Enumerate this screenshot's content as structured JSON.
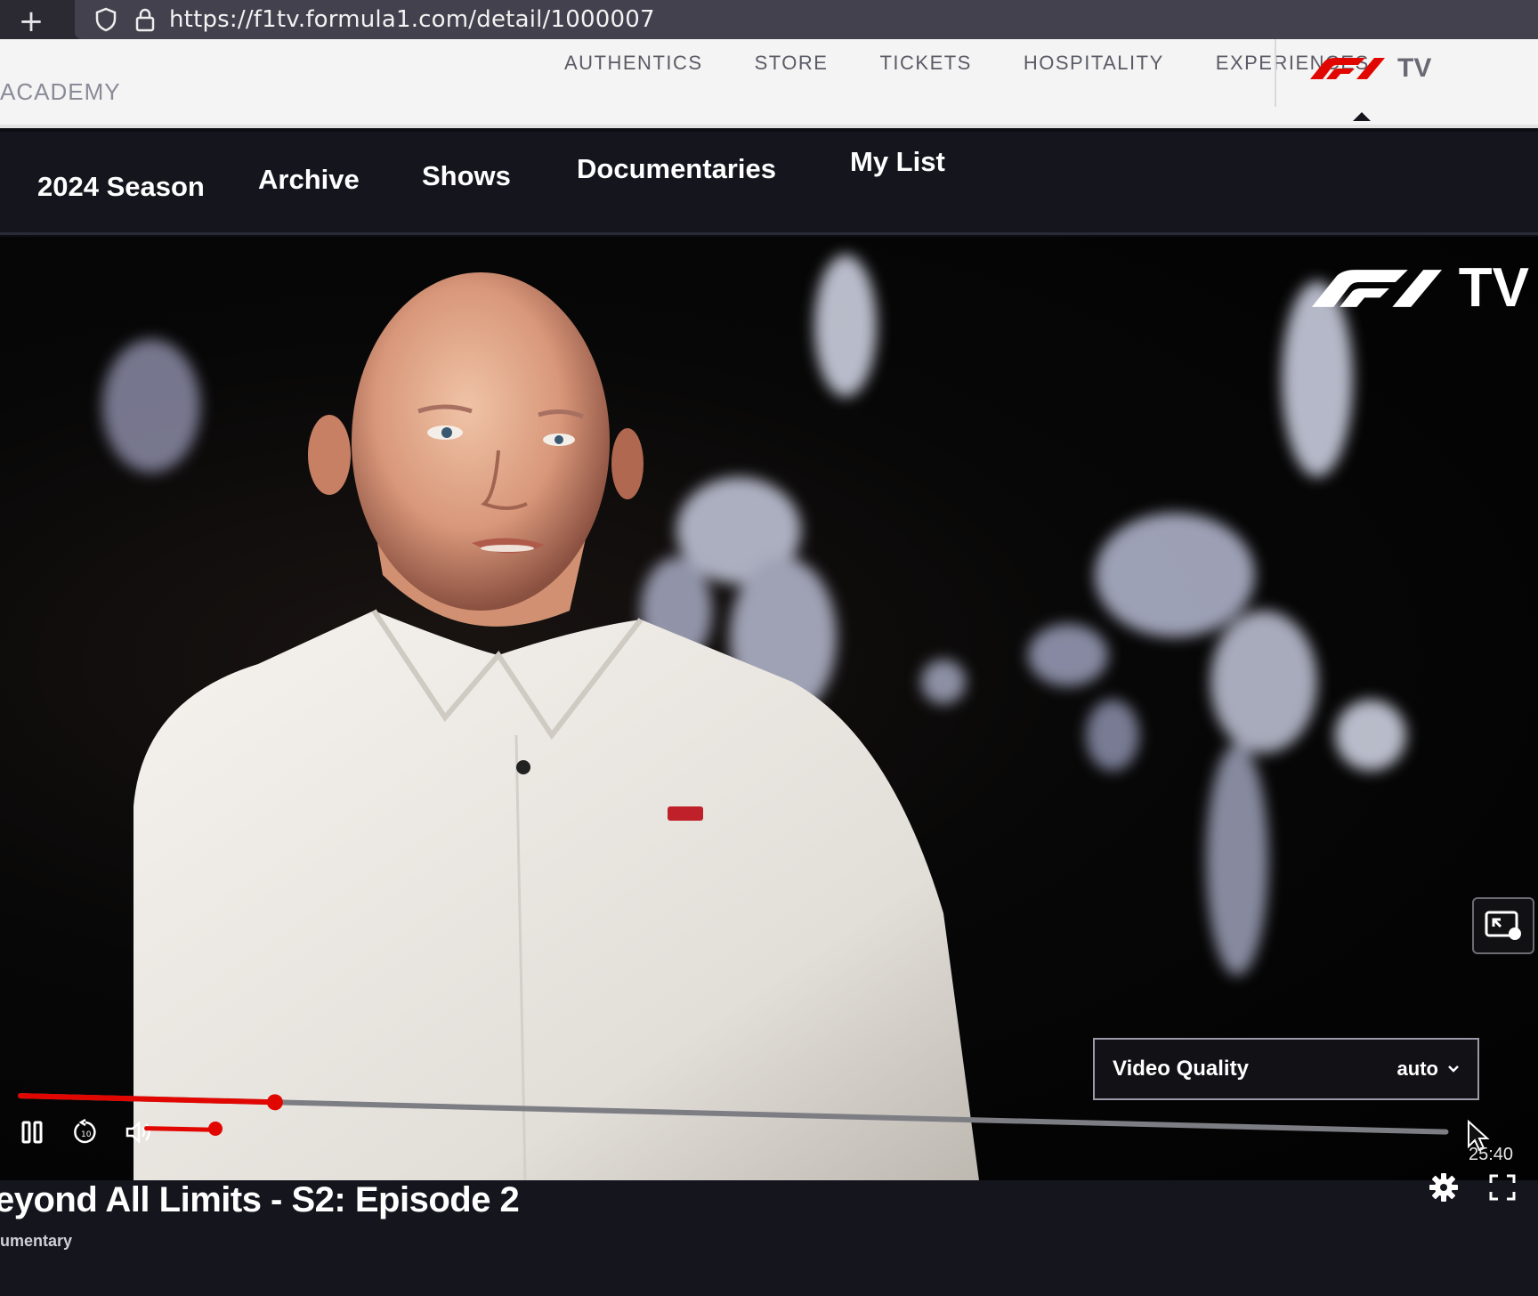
{
  "browser": {
    "url": "https://f1tv.formula1.com/detail/1000007",
    "icons": [
      "plus-icon",
      "shield-icon",
      "lock-icon"
    ]
  },
  "top_nav": {
    "left_label": "ACADEMY",
    "items": [
      "AUTHENTICS",
      "STORE",
      "TICKETS",
      "HOSPITALITY",
      "EXPERIENCES"
    ],
    "brand_suffix": "TV"
  },
  "main_nav": {
    "items": [
      "2024 Season",
      "Archive",
      "Shows",
      "Documentaries",
      "My List"
    ]
  },
  "player": {
    "watermark_suffix": "TV",
    "progress_fraction": 0.18,
    "volume_fraction": 0.85,
    "time_remaining": "25:40",
    "video_quality": {
      "label": "Video Quality",
      "value": "auto"
    }
  },
  "episode": {
    "title": "eyond All Limits - S2: Episode 2",
    "category": "umentary"
  },
  "colors": {
    "f1_red": "#e10600",
    "nav_dark": "#15151e",
    "nav_light": "#f4f4f4"
  }
}
